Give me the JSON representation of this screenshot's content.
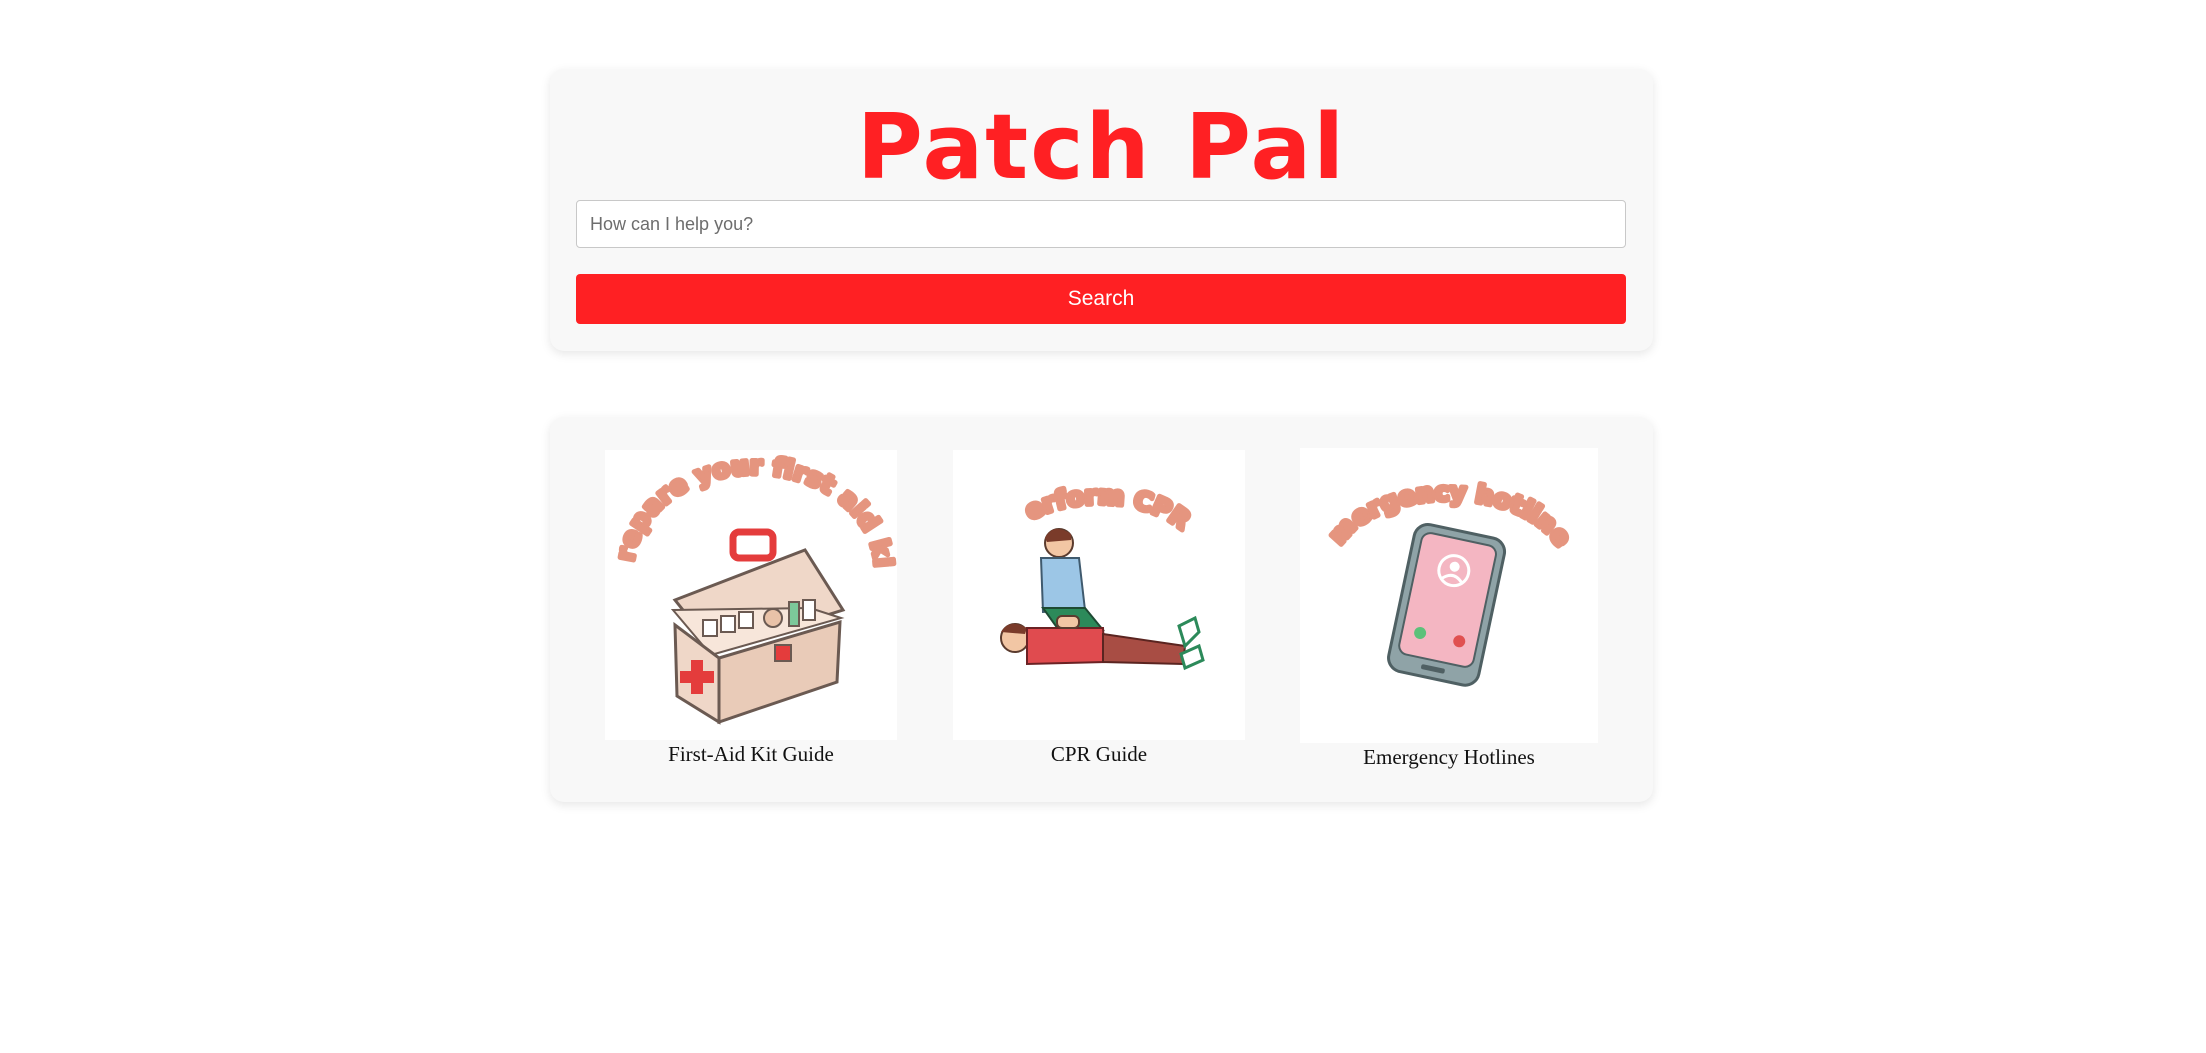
{
  "header": {
    "title": "Patch Pal"
  },
  "search": {
    "placeholder": "How can I help you?",
    "value": "",
    "button_label": "Search"
  },
  "cards": [
    {
      "image_caption": "prepare your first aid kit",
      "label": "First-Aid Kit Guide",
      "icon": "first-aid-kit-icon"
    },
    {
      "image_caption": "perform CPR",
      "label": "CPR Guide",
      "icon": "cpr-icon"
    },
    {
      "image_caption": "emergency hotlines",
      "label": "Emergency Hotlines",
      "icon": "phone-call-icon"
    }
  ],
  "colors": {
    "accent": "#ff2023",
    "panel_background": "#f8f8f8",
    "illustration_text": "#e5957f"
  }
}
